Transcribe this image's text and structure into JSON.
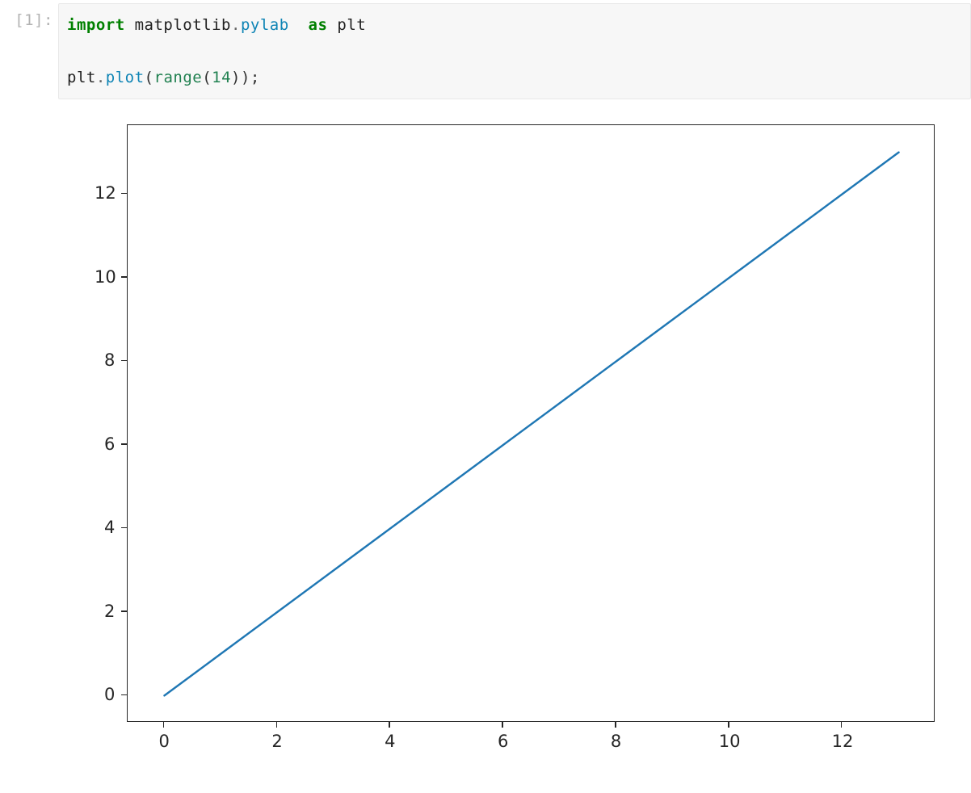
{
  "prompt_label": "[1]:",
  "code_tokens": [
    {
      "t": "import",
      "c": "kw"
    },
    {
      "t": " ",
      "c": "n"
    },
    {
      "t": "matplotlib",
      "c": "n"
    },
    {
      "t": ".",
      "c": "op"
    },
    {
      "t": "pylab",
      "c": "nn"
    },
    {
      "t": "  ",
      "c": "n"
    },
    {
      "t": "as",
      "c": "kw"
    },
    {
      "t": " ",
      "c": "n"
    },
    {
      "t": "plt",
      "c": "n"
    },
    {
      "t": "\n\n",
      "c": "n"
    },
    {
      "t": "plt",
      "c": "n"
    },
    {
      "t": ".",
      "c": "op"
    },
    {
      "t": "plot",
      "c": "nn"
    },
    {
      "t": "(",
      "c": "p"
    },
    {
      "t": "range",
      "c": "num"
    },
    {
      "t": "(",
      "c": "p"
    },
    {
      "t": "14",
      "c": "num"
    },
    {
      "t": "));",
      "c": "p"
    }
  ],
  "chart_data": {
    "type": "line",
    "x": [
      0,
      1,
      2,
      3,
      4,
      5,
      6,
      7,
      8,
      9,
      10,
      11,
      12,
      13
    ],
    "y": [
      0,
      1,
      2,
      3,
      4,
      5,
      6,
      7,
      8,
      9,
      10,
      11,
      12,
      13
    ],
    "xlim": [
      -0.65,
      13.65
    ],
    "ylim": [
      -0.65,
      13.65
    ],
    "xticks": [
      0,
      2,
      4,
      6,
      8,
      10,
      12
    ],
    "yticks": [
      0,
      2,
      4,
      6,
      8,
      10,
      12
    ],
    "line_color": "#1f77b4",
    "axes_color": "#262626",
    "xlabel": "",
    "ylabel": "",
    "title": ""
  },
  "layout": {
    "axes_left": 85,
    "axes_top": 25,
    "axes_width": 1000,
    "axes_height": 740
  }
}
